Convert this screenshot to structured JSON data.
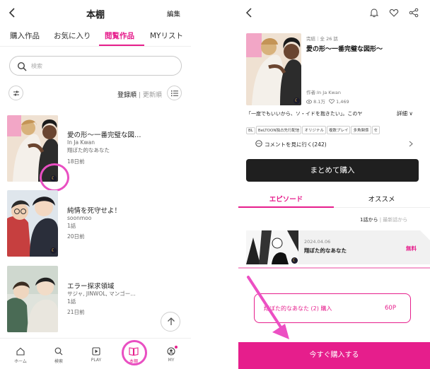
{
  "left": {
    "header": {
      "title": "本棚",
      "edit_label": "編集"
    },
    "tabs": [
      {
        "label": "購入作品",
        "active": false
      },
      {
        "label": "お気に入り",
        "active": false
      },
      {
        "label": "閲覧作品",
        "active": true
      },
      {
        "label": "MYリスト",
        "active": false
      }
    ],
    "search": {
      "placeholder": "検索"
    },
    "sort": {
      "primary": "登録順",
      "separator": "|",
      "secondary": "更新順"
    },
    "items": [
      {
        "title": "愛の形〜一番完璧な図…",
        "author": "In Ja Kwan",
        "episode": "翔ぼた的なあなた",
        "time": "18日前"
      },
      {
        "title": "純情を死守せよ！",
        "author": "soonmoo",
        "episode": "1話",
        "time": "20日前"
      },
      {
        "title": "エラー探求領域",
        "author": "サジャ, JINWOL, マンゴー…",
        "episode": "1話",
        "time": "21日前"
      }
    ],
    "bottom_nav": [
      {
        "label": "ホーム",
        "icon": "home-icon",
        "active": false
      },
      {
        "label": "検索",
        "icon": "search-icon",
        "active": false
      },
      {
        "label": "PLAY",
        "icon": "play-icon",
        "active": false
      },
      {
        "label": "本棚",
        "icon": "book-icon",
        "active": true
      },
      {
        "label": "MY",
        "icon": "user-icon",
        "active": false
      }
    ],
    "badge_glyph": "☾"
  },
  "right": {
    "work": {
      "status": "完結｜全 26 話",
      "title": "愛の形〜一番完璧な図形〜",
      "author": "作者:In Ja Kwan",
      "views": "8.1万",
      "likes": "1,469",
      "description": "「一度でもいいから、ソ・イドを抱きたい」。このヤ",
      "detail_label": "詳細 ∨",
      "tags": [
        "BL",
        "BeLTOON独占先行配信",
        "オリジナル",
        "複数プレイ",
        "多角関係",
        "セ"
      ],
      "comments_label": "コメントを見に行く(242)"
    },
    "buy_all_label": "まとめて購入",
    "tabs": [
      {
        "label": "エピソード",
        "active": true
      },
      {
        "label": "オススメ",
        "active": false
      }
    ],
    "order": {
      "primary": "1話から",
      "separator": "|",
      "secondary": "最新話から"
    },
    "episode": {
      "date": "2024.04.06",
      "title": "翔ぼた的なあなた",
      "price_label": "無料"
    },
    "purchase_item": {
      "label": "翔ぼた的なあなた (2) 購入",
      "price": "60P"
    },
    "buy_now_label": "今すぐ購入する"
  },
  "colors": {
    "accent": "#e61e8c",
    "dark_button": "#1f1f1f"
  }
}
